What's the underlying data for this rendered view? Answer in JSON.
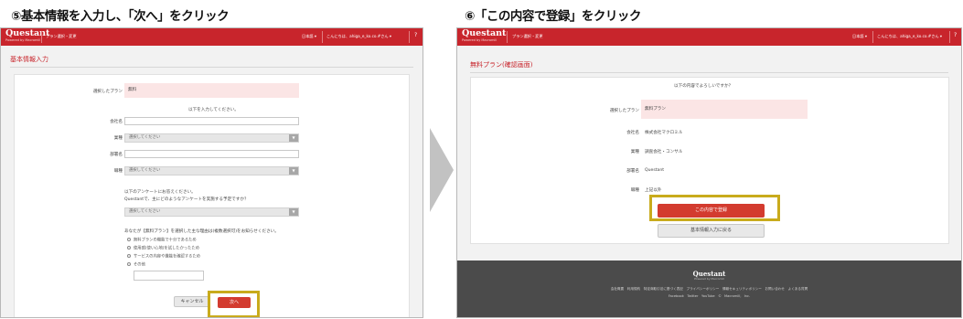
{
  "steps": {
    "step5": "⑤基本情報を入力し、「次へ」をクリック",
    "step6": "⑥「この内容で登録」をクリック"
  },
  "app": {
    "logo": "Questant",
    "logo_sub": "Powered by Macromill",
    "nav_plan": "プラン選択・変更",
    "lang": "日本語 ▾",
    "greeting": "こんにちは、ahiga_e_ko.co.#さん ▾",
    "help": "?"
  },
  "colors": {
    "brand": "#c8252c",
    "button_red": "#d33b2f",
    "highlight": "#c9ab1c",
    "footer": "#4b4b4b"
  },
  "form": {
    "title": "基本情報入力",
    "selected_plan_label": "選択したプラン",
    "selected_plan_value": "無料",
    "instruction": "以下を入力してください。",
    "company_label": "会社名",
    "industry_label": "業種",
    "industry_value": "選択してください",
    "department_label": "部署名",
    "job_label": "職種",
    "job_value": "選択してください",
    "question1_line1": "以下のアンケートにお答えください。",
    "question1_line2": "Questantで、主にどのようなアンケートを実施する予定ですか？",
    "survey_type_value": "選択してください",
    "question2": "あなたが【無料プラン】を選択した主な理由は(複数選択可)をお知らせください。",
    "reasons": [
      "無料プランの機能で十分であるため",
      "使用感(使い心地)を試したかったため",
      "サービスの内容や機能を確認するため",
      "その他"
    ],
    "cancel_label": "キャンセル",
    "next_label": "次へ"
  },
  "confirm": {
    "title": "無料プラン(確認画面)",
    "question": "以下の内容でよろしいですか？",
    "selected_plan_label": "選択したプラン",
    "selected_plan_value": "無料プラン",
    "company_label": "会社名",
    "company_value": "株式会社マクロミル",
    "industry_label": "業種",
    "industry_value": "調査会社・コンサル",
    "department_label": "部署名",
    "department_value": "Questant",
    "job_label": "職種",
    "job_value": "上記以外",
    "register_label": "この内容で登録",
    "back_label": "基本情報入力に戻る"
  },
  "footer": {
    "logo": "Questant",
    "logo_sub": "Powered by Macromill",
    "links": "会社概要　利用規約　特定商取引法に基づく表記　プライバシーポリシー　情報セキュリティポリシー　お問い合わせ　よくある質問",
    "social": "Facebook　Twitter　YouTube　© Macromill, Inc."
  }
}
